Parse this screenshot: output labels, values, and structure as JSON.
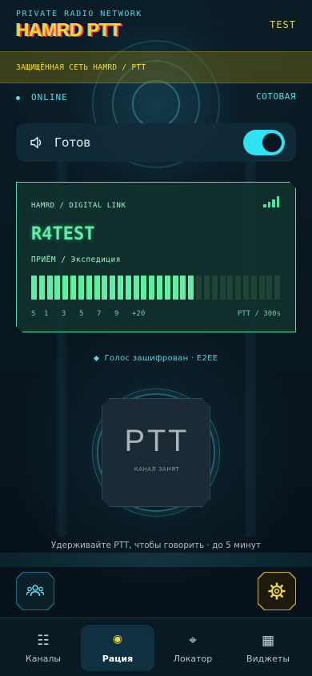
{
  "header": {
    "network_label": "PRIVATE RADIO NETWORK",
    "brand": "HAMRD PTT",
    "user": "TEST"
  },
  "banner": {
    "text": "ЗАЩИЩЁННАЯ СЕТЬ HAMRD / PTT"
  },
  "status": {
    "connection": "ONLINE",
    "network_type": "СОТОВАЯ"
  },
  "audio": {
    "ready_label": "Готов",
    "enabled": true
  },
  "link": {
    "title": "HAMRD / DIGITAL LINK",
    "callsign": "R4TEST",
    "rx_label": "ПРИЁМ / Экспедиция",
    "level_fraction": 0.66,
    "scale_ticks": [
      "S",
      "1",
      "3",
      "5",
      "7",
      "9",
      "+20"
    ],
    "ptt_timer": "PTT / 300s",
    "signal_bars": 4
  },
  "encryption": {
    "text": "Голос зашифрован · E2EE"
  },
  "ptt": {
    "label": "PTT",
    "sublabel": "КАНАЛ ЗАНЯТ"
  },
  "hint": "Удерживайте PTT, чтобы говорить · до 5 минут",
  "fabs": {
    "left_icon": "users-icon",
    "right_icon": "gear-icon"
  },
  "tabs": [
    {
      "label": "Каналы",
      "icon": "list-icon",
      "active": false
    },
    {
      "label": "Рация",
      "icon": "radio-icon",
      "active": true
    },
    {
      "label": "Локатор",
      "icon": "crosshair-icon",
      "active": false
    },
    {
      "label": "Виджеты",
      "icon": "grid-icon",
      "active": false
    }
  ],
  "colors": {
    "accent_cyan": "#2ee4f2",
    "brand_yellow": "#ffd21f",
    "meter_green": "#5ef0a5",
    "banner_text": "#f2dd3d"
  }
}
